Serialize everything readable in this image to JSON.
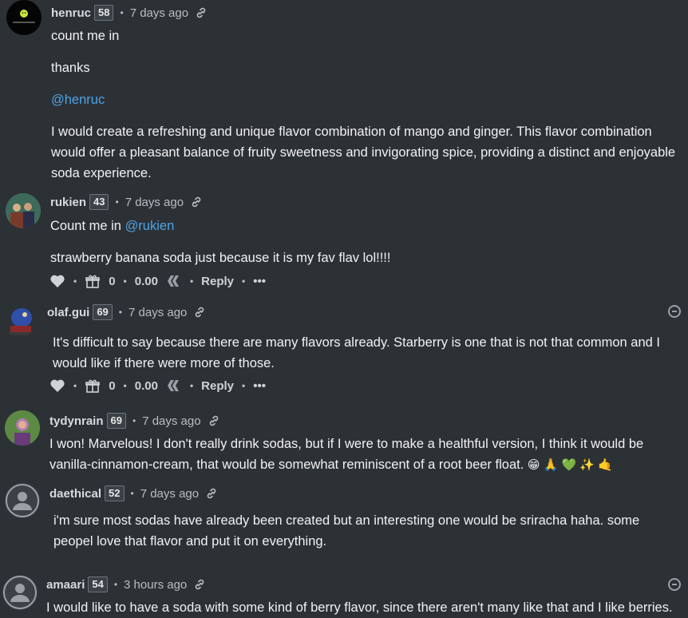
{
  "comments": [
    {
      "username": "henruc",
      "reputation": "58",
      "time": "7 days ago",
      "paragraphs": [
        "count me in",
        "thanks"
      ],
      "mention": "@henruc",
      "paragraph_long": "I would create a refreshing and unique flavor combination of mango and ginger. This flavor combination would offer a pleasant balance of fruity sweetness and invigorating spice, providing a distinct and enjoyable soda experience."
    },
    {
      "username": "rukien",
      "reputation": "43",
      "time": "7 days ago",
      "text_before_mention": "Count me in",
      "mention": "@rukien",
      "paragraph": "strawberry banana soda just because it is my fav flav lol!!!!",
      "votes": "0",
      "payout": "0.00",
      "reply_label": "Reply",
      "more_label": "•••"
    },
    {
      "username": "olaf.gui",
      "reputation": "69",
      "time": "7 days ago",
      "paragraph": "It's difficult to say because there are many flavors already. Starberry is one that is not that common and I would like if there were more of those.",
      "votes": "0",
      "payout": "0.00",
      "reply_label": "Reply",
      "more_label": "•••"
    },
    {
      "username": "tydynrain",
      "reputation": "69",
      "time": "7 days ago",
      "paragraph": "I won! Marvelous! I don't really drink sodas, but if I were to make a healthful version, I think it would be vanilla-cinnamon-cream, that would be somewhat reminiscent of a root beer float.",
      "emojis": "😁 🙏 💚 ✨ 🤙"
    },
    {
      "username": "daethical",
      "reputation": "52",
      "time": "7 days ago",
      "paragraph": "i'm sure most sodas have already been created but an interesting one would be sriracha haha. some peopel love that flavor and put it on everything."
    },
    {
      "username": "amaari",
      "reputation": "54",
      "time": "3 hours ago",
      "paragraph": "I would like to have a soda with some kind of berry flavor, since there aren't many like that and I like berries."
    }
  ],
  "colors": {
    "background": "#2c3136",
    "text": "#f2f2f2",
    "muted": "#b9bec3",
    "mention": "#4ea3e6"
  }
}
